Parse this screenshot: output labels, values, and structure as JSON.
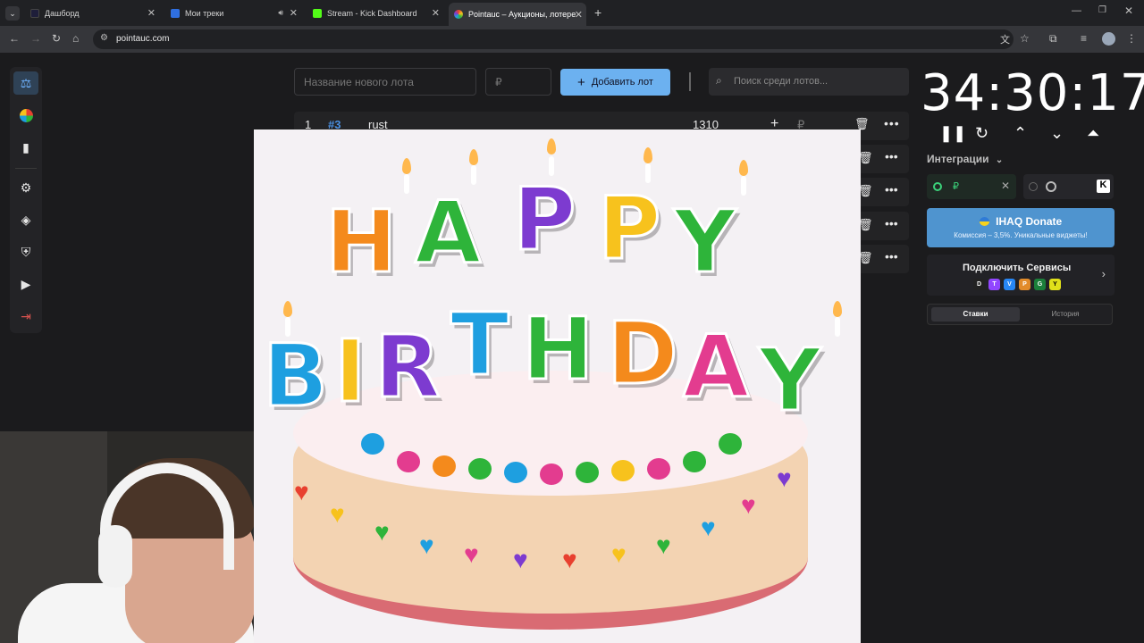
{
  "browser": {
    "tabs": [
      {
        "title": "Дашборд",
        "favicon_color": "#1e1e3a"
      },
      {
        "title": "Мои треки",
        "favicon_color": "#2f6fe0"
      },
      {
        "title": "Stream - Kick Dashboard",
        "favicon_color": "#53fc18"
      },
      {
        "title": "Pointauc – Аукционы, лотере…",
        "favicon_color": "#b85cff"
      }
    ],
    "new_tab": "+",
    "url": "pointauc.com"
  },
  "sidebar": {
    "items": [
      "auction-icon",
      "wheel-icon",
      "stats-icon",
      "settings-icon",
      "layers-icon",
      "shield-icon",
      "media-icon",
      "logout-icon"
    ]
  },
  "toolbar": {
    "lot_name_placeholder": "Название нового лота",
    "amount_placeholder": "₽",
    "add_lot_label": "Добавить лот",
    "search_placeholder": "Поиск среди лотов..."
  },
  "lots": [
    {
      "num": "1",
      "tag": "#3",
      "name": "rust",
      "amount": "1310",
      "currency": "₽"
    }
  ],
  "overlay": {
    "word1": "HAPPY",
    "word2": "BIRTHDAY",
    "colors": [
      "#e8402f",
      "#f48a1c",
      "#f7c21d",
      "#2eb43a",
      "#1e9fe0",
      "#7d3bd0",
      "#e33c8f"
    ]
  },
  "timer": {
    "value": "34:30:17"
  },
  "integrations": {
    "title": "Интеграции",
    "currency": "₽",
    "donate_title": "IHAQ Donate",
    "donate_subtitle": "Комиссия – 3,5%. Уникальные виджеты!",
    "services_title": "Подключить Сервисы",
    "service_icons": [
      "D",
      "T",
      "V",
      "P",
      "G",
      "Y"
    ]
  },
  "history_tabs": {
    "bets": "Ставки",
    "history": "История"
  }
}
